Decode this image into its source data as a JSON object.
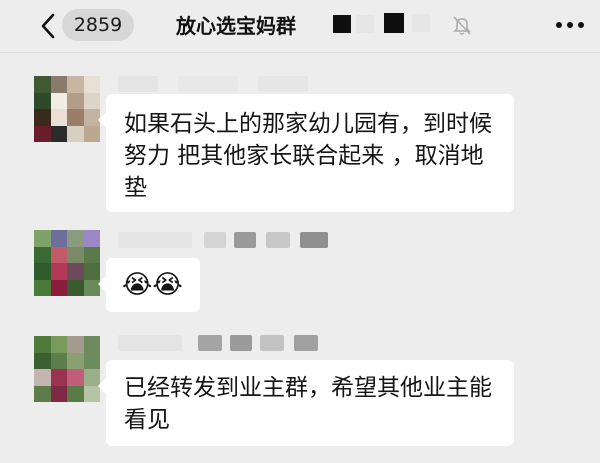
{
  "header": {
    "unread_count": "2859",
    "title": "放心选宝妈群",
    "icons": {
      "back": "chevron-left-icon",
      "mute": "bell-muted-icon",
      "more": "more-dots-icon"
    }
  },
  "messages": [
    {
      "sender_nickname": "",
      "text": "如果石头上的那家幼儿园有，到时候努力 把其他家长联合起来 ，取消地垫"
    },
    {
      "sender_nickname": "",
      "text": "😭😭"
    },
    {
      "sender_nickname": "",
      "text": "已经转发到业主群，希望其他业主能看见"
    }
  ],
  "colors": {
    "background": "#ededed",
    "bubble": "#ffffff",
    "header": "#ededed"
  }
}
